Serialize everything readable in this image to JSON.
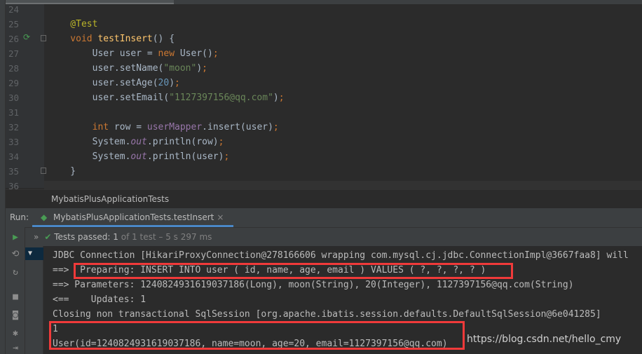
{
  "editor": {
    "line_numbers": [
      "24",
      "25",
      "26",
      "27",
      "28",
      "29",
      "30",
      "31",
      "32",
      "33",
      "34",
      "35",
      "36"
    ],
    "code": [
      [],
      [
        [
          "ann",
          "    @Test"
        ]
      ],
      [
        [
          "kw",
          "    void "
        ],
        [
          "fn",
          "testInsert"
        ],
        [
          "",
          "() {"
        ]
      ],
      [
        [
          "",
          "        User user = "
        ],
        [
          "kw",
          "new "
        ],
        [
          "",
          "User()"
        ],
        [
          "kw",
          ";"
        ]
      ],
      [
        [
          "",
          "        user.setName("
        ],
        [
          "str",
          "\"moon\""
        ],
        [
          "",
          ")"
        ],
        [
          "kw",
          ";"
        ]
      ],
      [
        [
          "",
          "        user.setAge("
        ],
        [
          "num",
          "20"
        ],
        [
          "",
          ")"
        ],
        [
          "kw",
          ";"
        ]
      ],
      [
        [
          "",
          "        user.setEmail("
        ],
        [
          "str",
          "\"1127397156@qq.com\""
        ],
        [
          "",
          ")"
        ],
        [
          "kw",
          ";"
        ]
      ],
      [],
      [
        [
          "kw",
          "        int "
        ],
        [
          "",
          "row = "
        ],
        [
          "fld",
          "userMapper"
        ],
        [
          "",
          ".insert(user)"
        ],
        [
          "kw",
          ";"
        ]
      ],
      [
        [
          "",
          "        System."
        ],
        [
          "st",
          "out"
        ],
        [
          "",
          ".println(row)"
        ],
        [
          "kw",
          ";"
        ]
      ],
      [
        [
          "",
          "        System."
        ],
        [
          "st",
          "out"
        ],
        [
          "",
          ".println(user)"
        ],
        [
          "kw",
          ";"
        ]
      ],
      [
        [
          "",
          "    }"
        ]
      ],
      []
    ]
  },
  "breadcrumb": "MybatisPlusApplicationTests",
  "run": {
    "label": "Run:",
    "tab": "MybatisPlusApplicationTests.testInsert",
    "close": "×"
  },
  "tests": {
    "status": "Tests passed: ",
    "count": "1",
    "detail": " of 1 test – 5 s 297 ms"
  },
  "console": [
    "JDBC Connection [HikariProxyConnection@278166606 wrapping com.mysql.cj.jdbc.ConnectionImpl@3667faa8] will",
    "==>  Preparing: INSERT INTO user ( id, name, age, email ) VALUES ( ?, ?, ?, ? )",
    "==> Parameters: 1240824931619037186(Long), moon(String), 20(Integer), 1127397156@qq.com(String)",
    "<==    Updates: 1",
    "Closing non transactional SqlSession [org.apache.ibatis.session.defaults.DefaultSqlSession@6e041285]",
    "1",
    "User(id=1240824931619037186, name=moon, age=20, email=1127397156@qq.com)"
  ],
  "watermark": "https://blog.csdn.net/hello_cmy",
  "colors": {
    "highlight_box": "#f03a3a",
    "accent": "#4a88c7",
    "pass": "#499c54"
  }
}
